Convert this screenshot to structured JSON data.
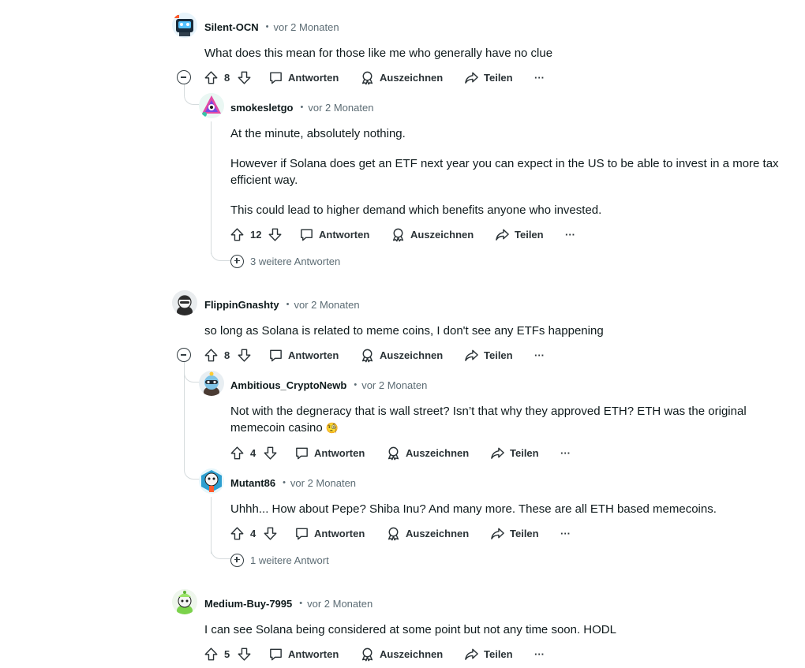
{
  "ui": {
    "reply": "Antworten",
    "award": "Auszeichnen",
    "share": "Teilen",
    "more": "···",
    "dot": "•"
  },
  "comments": [
    {
      "author": "Silent-OCN",
      "time": "vor 2 Monaten",
      "body": [
        "What does this mean for those like me who generally have no clue"
      ],
      "votes": "8"
    },
    {
      "author": "smokesletgo",
      "time": "vor 2 Monaten",
      "body": [
        "At the minute, absolutely nothing.",
        "However if Solana does get an ETF next year you can expect in the US to be able to invest in a more tax efficient way.",
        "This could lead to higher demand which benefits anyone who invested."
      ],
      "votes": "12",
      "more_replies": "3 weitere Antworten"
    },
    {
      "author": "FlippinGnashty",
      "time": "vor 2 Monaten",
      "body": [
        "so long as Solana is related to meme coins, I don't see any ETFs happening"
      ],
      "votes": "8"
    },
    {
      "author": "Ambitious_CryptoNewb",
      "time": "vor 2 Monaten",
      "body": [
        "Not with the degneracy that is wall street? Isn’t that why they approved ETH? ETH was the original memecoin casino"
      ],
      "emoji": "🧐",
      "votes": "4"
    },
    {
      "author": "Mutant86",
      "time": "vor 2 Monaten",
      "body": [
        "Uhhh... How about Pepe? Shiba Inu? And many more. These are all ETH based memecoins."
      ],
      "votes": "4",
      "more_replies": "1 weitere Antwort"
    },
    {
      "author": "Medium-Buy-7995",
      "time": "vor 2 Monaten",
      "body": [
        "I can see Solana being considered at some point but not any time soon. HODL"
      ],
      "votes": "5"
    }
  ]
}
